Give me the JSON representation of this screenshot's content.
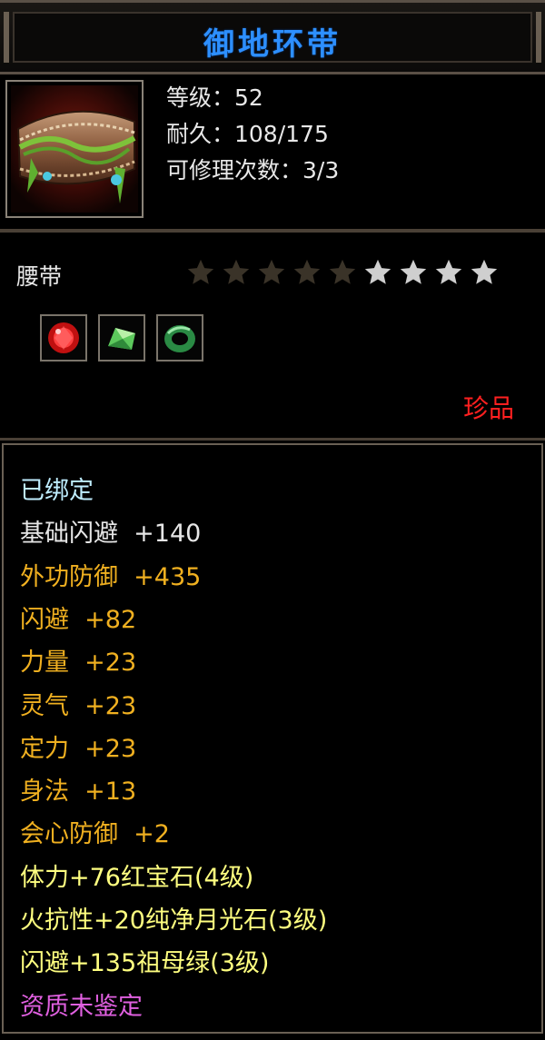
{
  "title": "御地环带",
  "item": {
    "icon": "belt-icon",
    "level_line": "等级：52",
    "durability_line": "耐久：108/175",
    "repair_line": "可修理次数：3/3"
  },
  "type_label": "腰带",
  "stars": {
    "filled": 5,
    "total": 9,
    "colors": {
      "filled": "#3a3328",
      "empty": "#cfcfcf"
    }
  },
  "gems": [
    {
      "icon": "red-ruby-gem-icon",
      "color": "#e02020"
    },
    {
      "icon": "green-crystal-gem-icon",
      "color": "#7ddf7d"
    },
    {
      "icon": "green-jade-ring-gem-icon",
      "color": "#30a050"
    }
  ],
  "rarity": "珍品",
  "attributes": [
    {
      "text": "已绑定",
      "color": "cyan"
    },
    {
      "text": "基础闪避  +140",
      "color": "white"
    },
    {
      "text": "外功防御  +435",
      "color": "gold"
    },
    {
      "text": "闪避  +82",
      "color": "gold"
    },
    {
      "text": "力量  +23",
      "color": "gold"
    },
    {
      "text": "灵气  +23",
      "color": "gold"
    },
    {
      "text": "定力  +23",
      "color": "gold"
    },
    {
      "text": "身法  +13",
      "color": "gold"
    },
    {
      "text": "会心防御  +2",
      "color": "gold"
    },
    {
      "text": "体力+76红宝石(4级)",
      "color": "yellow"
    },
    {
      "text": "火抗性+20纯净月光石(3级)",
      "color": "yellow"
    },
    {
      "text": "闪避+135祖母绿(3级)",
      "color": "yellow"
    },
    {
      "text": "资质未鉴定",
      "color": "purple"
    }
  ]
}
